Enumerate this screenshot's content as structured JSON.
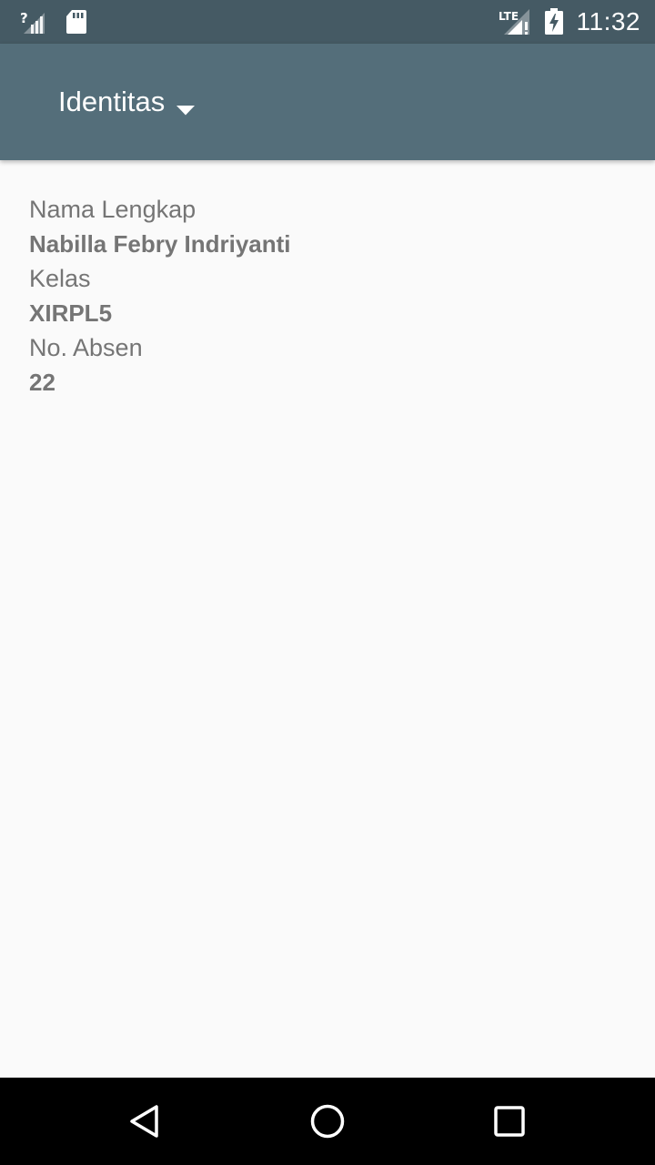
{
  "status_bar": {
    "time": "11:32",
    "icons": [
      "signal-unknown-icon",
      "sd-card-icon",
      "lte-signal-alert-icon",
      "battery-charging-icon"
    ]
  },
  "app_bar": {
    "spinner_value": "Identitas",
    "spinner_icon": "dropdown-arrow-icon"
  },
  "identity": {
    "name_label": "Nama Lengkap",
    "name_value": "Nabilla Febry Indriyanti",
    "class_label": "Kelas",
    "class_value": "XIRPL5",
    "absence_label": "No. Absen",
    "absence_value": "22"
  },
  "nav_bar": {
    "buttons": [
      "back-icon",
      "home-icon",
      "recents-icon"
    ]
  },
  "colors": {
    "status_bar": "#455a64",
    "app_bar": "#546e7a",
    "background": "#fafafa",
    "text": "#757575",
    "nav_bar": "#000000"
  }
}
